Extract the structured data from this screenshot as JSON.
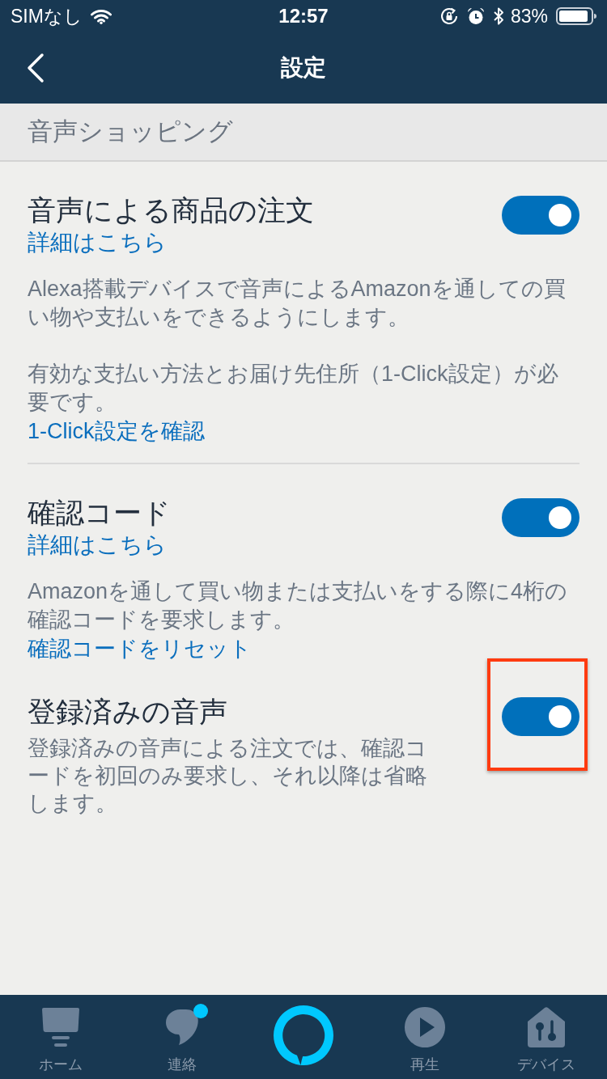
{
  "status_bar": {
    "carrier": "SIMなし",
    "time": "12:57",
    "battery": "83%"
  },
  "nav": {
    "title": "設定"
  },
  "section": {
    "title": "音声ショッピング"
  },
  "settings": [
    {
      "title": "音声による商品の注文",
      "link": "詳細はこちら",
      "description": [
        "Alexa搭載デバイスで音声によるAmazonを通しての買い物や支払いをできるようにします。",
        "有効な支払い方法とお届け先住所（1-Click設定）が必要です。"
      ],
      "action_link": "1-Click設定を確認",
      "on": true,
      "highlighted": false,
      "separator": true
    },
    {
      "title": "確認コード",
      "link": "詳細はこちら",
      "description": [
        "Amazonを通して買い物または支払いをする際に4桁の確認コードを要求します。"
      ],
      "action_link": "確認コードをリセット",
      "on": true,
      "highlighted": false,
      "separator": false
    },
    {
      "title": "登録済みの音声",
      "description": [
        "登録済みの音声による注文では、確認コードを初回のみ要求し、それ以降は省略します。"
      ],
      "on": true,
      "highlighted": true,
      "separator": false
    }
  ],
  "tab_bar": [
    {
      "kind": "tab",
      "label": "ホーム",
      "selected": false,
      "badge": false
    },
    {
      "kind": "tab",
      "label": "連絡",
      "selected": false,
      "badge": true
    },
    {
      "kind": "voice"
    },
    {
      "kind": "tab",
      "label": "再生",
      "selected": false,
      "badge": false
    },
    {
      "kind": "tab",
      "label": "デバイス",
      "selected": false,
      "badge": false
    }
  ]
}
